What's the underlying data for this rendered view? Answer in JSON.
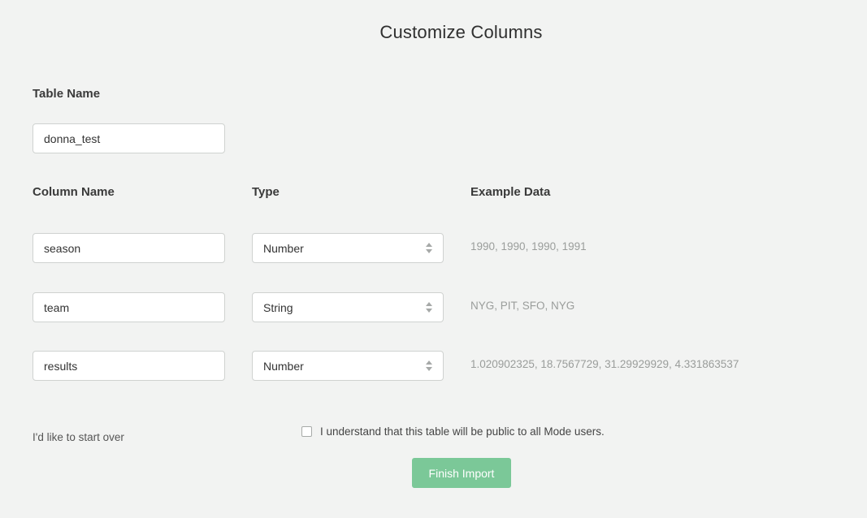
{
  "page": {
    "title": "Customize Columns"
  },
  "table_name": {
    "label": "Table Name",
    "value": "donna_test"
  },
  "headers": {
    "column_name": "Column Name",
    "type": "Type",
    "example_data": "Example Data"
  },
  "columns": [
    {
      "name": "season",
      "type": "Number",
      "example": "1990, 1990, 1990, 1991"
    },
    {
      "name": "team",
      "type": "String",
      "example": "NYG, PIT, SFO, NYG"
    },
    {
      "name": "results",
      "type": "Number",
      "example": "1.020902325, 18.7567729, 31.29929929, 4.331863537"
    }
  ],
  "footer": {
    "start_over": "I'd like to start over",
    "consent": "I understand that this table will be public to all Mode users.",
    "finish_label": "Finish Import"
  },
  "colors": {
    "background": "#f2f3f2",
    "accent_button": "#7bc898"
  }
}
